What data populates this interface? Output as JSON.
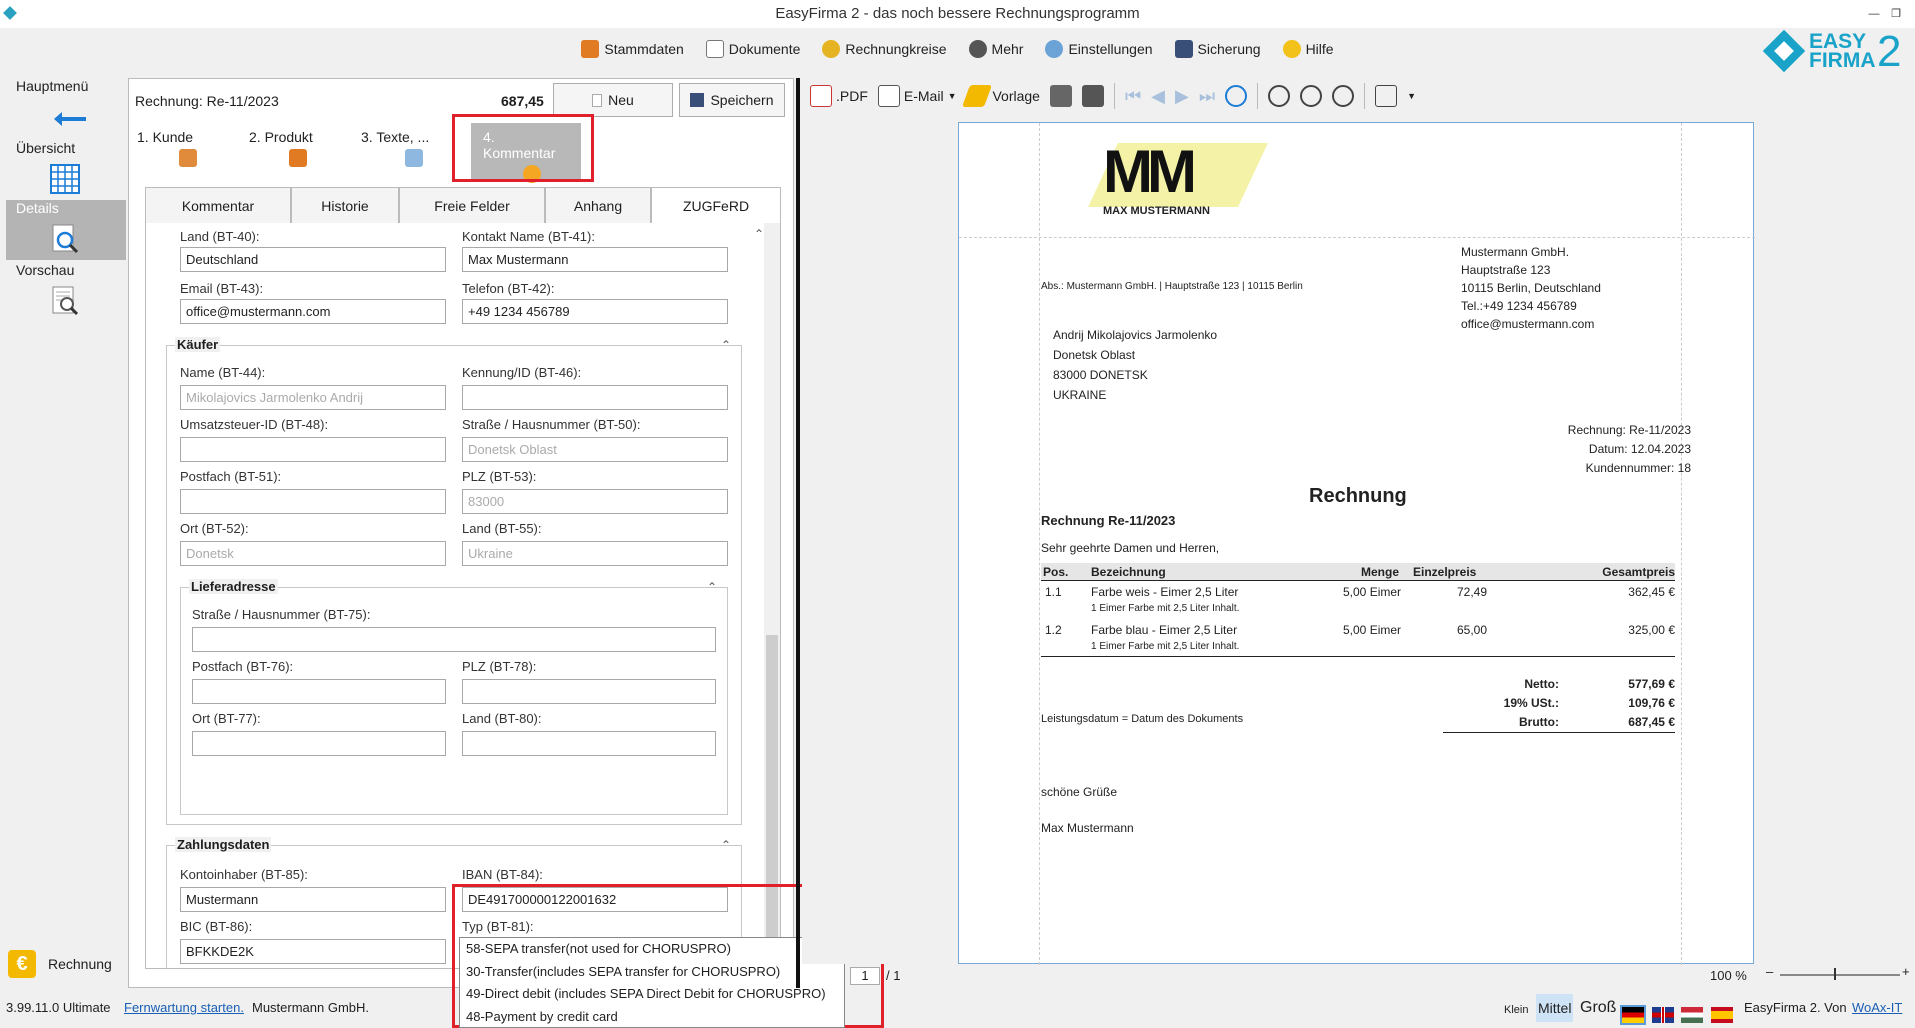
{
  "title": "EasyFirma 2 - das noch bessere Rechnungsprogramm",
  "menu": [
    "Stammdaten",
    "Dokumente",
    "Rechnungkreise",
    "Mehr",
    "Einstellungen",
    "Sicherung",
    "Hilfe"
  ],
  "logo": {
    "line1": "EASY",
    "line2": "FIRMA",
    "num": "2"
  },
  "sidebar": {
    "items": [
      "Hauptmenü",
      "Übersicht",
      "Details",
      "Vorschau"
    ],
    "bottom": "Rechnung"
  },
  "invoice": {
    "label": "Rechnung: Re-11/2023",
    "amount": "687,45",
    "new": "Neu",
    "save": "Speichern"
  },
  "steps": [
    "1. Kunde",
    "2. Produkt",
    "3. Texte, ...",
    "4. Kommentar"
  ],
  "tabs": [
    "Kommentar",
    "Historie",
    "Freie Felder",
    "Anhang",
    "ZUGFeRD"
  ],
  "form": {
    "land_label": "Land (BT-40):",
    "land": "Deutschland",
    "kontakt_label": "Kontakt Name (BT-41):",
    "kontakt": "Max Mustermann",
    "email_label": "Email (BT-43):",
    "email": "office@mustermann.com",
    "tel_label": "Telefon (BT-42):",
    "tel": "+49 1234 456789",
    "kaeufer": "Käufer",
    "name_label": "Name (BT-44):",
    "name": "Mikolajovics Jarmolenko Andrij",
    "kennung_label": "Kennung/ID (BT-46):",
    "ust_label": "Umsatzsteuer-ID (BT-48):",
    "strasse_label": "Straße / Hausnummer (BT-50):",
    "strasse": "Donetsk Oblast",
    "postfach_label": "Postfach (BT-51):",
    "plz_label": "PLZ (BT-53):",
    "plz": "83000",
    "ort_label": "Ort (BT-52):",
    "ort": "Donetsk",
    "land2_label": "Land (BT-55):",
    "land2": "Ukraine",
    "liefer": "Lieferadresse",
    "lstrasse_label": "Straße / Hausnummer (BT-75):",
    "lpostfach_label": "Postfach (BT-76):",
    "lplz_label": "PLZ (BT-78):",
    "lort_label": "Ort (BT-77):",
    "lland_label": "Land (BT-80):",
    "zahlung": "Zahlungsdaten",
    "inhaber_label": "Kontoinhaber (BT-85):",
    "inhaber": "Mustermann",
    "iban_label": "IBAN (BT-84):",
    "iban": "DE491700000122001632",
    "bic_label": "BIC (BT-86):",
    "bic": "BFKKDE2K",
    "typ_label": "Typ (BT-81):"
  },
  "dropdown": [
    "58-SEPA transfer(not used for CHORUSPRO)",
    "30-Transfer(includes SEPA transfer for CHORUSPRO)",
    "49-Direct debit (includes SEPA Direct Debit for CHORUSPRO)",
    "48-Payment by credit card"
  ],
  "preview_toolbar": {
    "pdf": ".PDF",
    "email": "E-Mail",
    "vorlage": "Vorlage"
  },
  "doc": {
    "logo_name": "MAX MUSTERMANN",
    "sender_line": "Abs.: Mustermann GmbH. | Hauptstraße 123 | 10115 Berlin",
    "company": [
      "Mustermann GmbH.",
      "Hauptstraße 123",
      "10115 Berlin, Deutschland",
      "Tel.:+49 1234 456789",
      "office@mustermann.com"
    ],
    "recipient": [
      "Andrij Mikolajovics Jarmolenko",
      "Donetsk Oblast",
      "83000 DONETSK",
      "UKRAINE"
    ],
    "meta": [
      "Rechnung: Re-11/2023",
      "Datum: 12.04.2023",
      "Kundennummer: 18"
    ],
    "heading": "Rechnung",
    "subject": "Rechnung Re-11/2023",
    "greeting": "Sehr geehrte Damen und Herren,",
    "cols": [
      "Pos.",
      "Bezeichnung",
      "Menge",
      "Einzelpreis",
      "Gesamtpreis"
    ],
    "rows": [
      {
        "pos": "1.1",
        "name": "Farbe weis - Eimer 2,5 Liter",
        "desc": "1 Eimer Farbe mit 2,5 Liter Inhalt.",
        "qty": "5,00 Eimer",
        "price": "72,49",
        "total": "362,45 €"
      },
      {
        "pos": "1.2",
        "name": "Farbe blau - Eimer 2,5 Liter",
        "desc": "1 Eimer Farbe mit 2,5 Liter Inhalt.",
        "qty": "5,00 Eimer",
        "price": "65,00",
        "total": "325,00 €"
      }
    ],
    "leistung": "Leistungsdatum = Datum des Dokuments",
    "netto_l": "Netto:",
    "netto": "577,69 €",
    "ust_l": "19%  USt.:",
    "ust": "109,76 €",
    "brutto_l": "Brutto:",
    "brutto": "687,45 €",
    "closing": "schöne Grüße",
    "signer": "Max Mustermann"
  },
  "pager": {
    "page": "1",
    "of": "/ 1",
    "zoom": "100 %"
  },
  "footer": {
    "version": "3.99.11.0 Ultimate",
    "link": "Fernwartung starten.",
    "company": "Mustermann GmbH.",
    "sizes": [
      "Klein",
      "Mittel",
      "Groß"
    ],
    "right": "EasyFirma 2. Von",
    "right_link": "WoAx-IT"
  }
}
